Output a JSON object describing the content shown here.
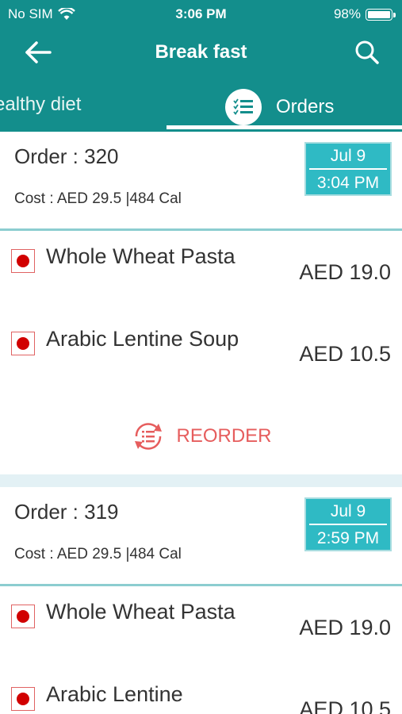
{
  "status": {
    "carrier": "No SIM",
    "time": "3:06 PM",
    "battery": "98%"
  },
  "header": {
    "title": "Break fast"
  },
  "tabs": {
    "healthy": "ealthy diet",
    "orders": "Orders"
  },
  "orders": [
    {
      "title": "Order : 320",
      "cost": "Cost : AED 29.5 |484 Cal",
      "date": "Jul 9",
      "time": "3:04 PM",
      "items": [
        {
          "name": "Whole Wheat Pasta",
          "price": "AED 19.0"
        },
        {
          "name": "Arabic Lentine Soup",
          "price": "AED 10.5"
        }
      ],
      "reorder": "REORDER"
    },
    {
      "title": "Order : 319",
      "cost": "Cost : AED 29.5 |484 Cal",
      "date": "Jul 9",
      "time": "2:59 PM",
      "items": [
        {
          "name": "Whole Wheat Pasta",
          "price": "AED 19.0"
        },
        {
          "name": "Arabic Lentine",
          "price": "AED 10.5"
        }
      ]
    }
  ],
  "colors": {
    "primary": "#138e8c",
    "accent": "#2fbac4",
    "reorder": "#e65d5d",
    "veg_dot": "#d10000"
  },
  "icons": {
    "back": "arrow-left-icon",
    "search": "search-icon",
    "orders_tab": "checklist-icon",
    "reorder": "reorder-icon",
    "wifi": "wifi-icon",
    "battery": "battery-icon",
    "item": "food-indicator-icon"
  }
}
